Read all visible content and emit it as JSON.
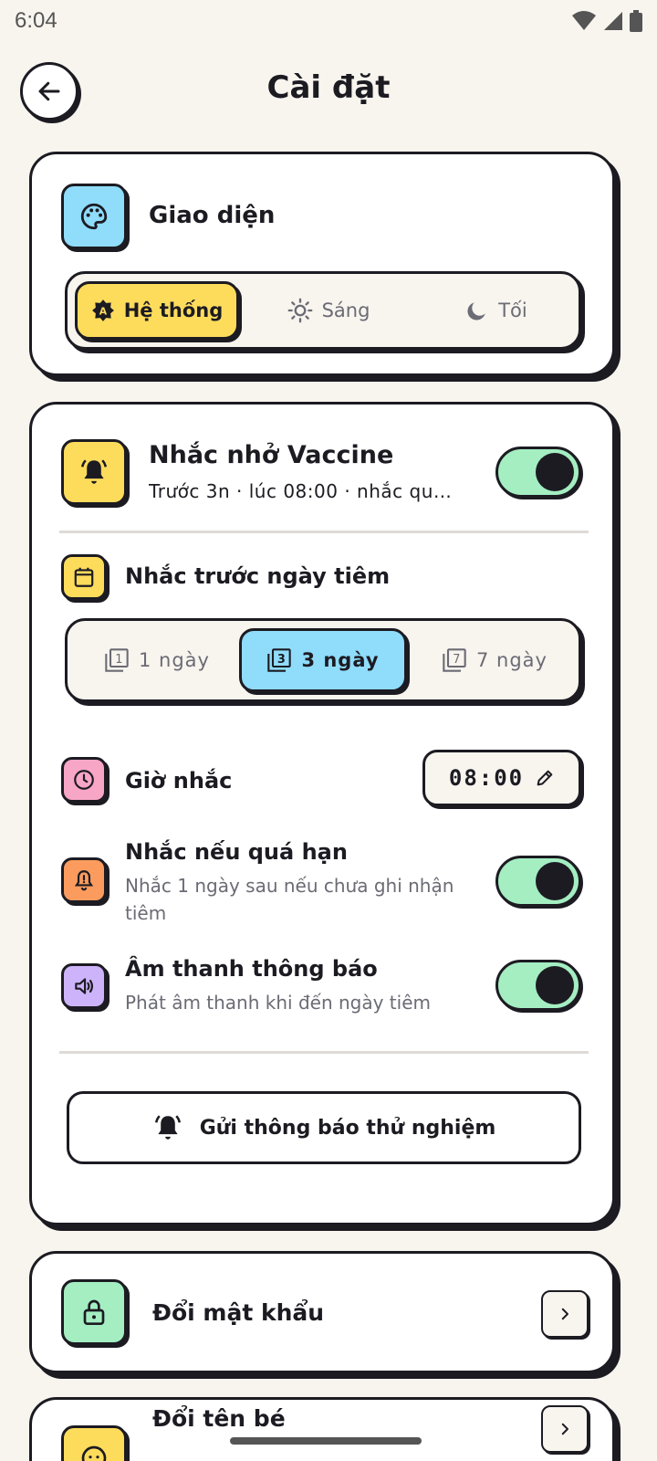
{
  "status_bar": {
    "time": "6:04"
  },
  "header": {
    "title": "Cài đặt"
  },
  "appearance": {
    "title": "Giao diện",
    "options": [
      {
        "label": "Hệ thống",
        "icon": "auto-theme-icon",
        "active": true
      },
      {
        "label": "Sáng",
        "icon": "sun-icon",
        "active": false
      },
      {
        "label": "Tối",
        "icon": "moon-icon",
        "active": false
      }
    ]
  },
  "vaccine": {
    "title": "Nhắc nhở Vaccine",
    "summary": "Trước 3n · lúc 08:00 · nhắc qu…",
    "enabled": true,
    "days_title": "Nhắc trước ngày tiêm",
    "days_options": [
      {
        "label": "1 ngày",
        "icon": "filter-1-icon",
        "active": false
      },
      {
        "label": "3 ngày",
        "icon": "filter-3-icon",
        "active": true
      },
      {
        "label": "7 ngày",
        "icon": "filter-7-icon",
        "active": false
      }
    ],
    "time_title": "Giờ nhắc",
    "time_value": "08:00",
    "overdue_title": "Nhắc nếu quá hạn",
    "overdue_desc": "Nhắc 1 ngày sau nếu chưa ghi nhận tiêm",
    "overdue_enabled": true,
    "sound_title": "Âm thanh thông báo",
    "sound_desc": "Phát âm thanh khi đến ngày tiêm",
    "sound_enabled": true,
    "test_button": "Gửi thông báo thử nghiệm"
  },
  "password": {
    "title": "Đổi mật khẩu"
  },
  "rename": {
    "title": "Đổi tên bé"
  },
  "colors": {
    "background": "#f8f4ee",
    "yellow": "#fddc5c",
    "blue": "#8fdcfb",
    "green": "#a4eec2",
    "pink": "#f8a6c6",
    "orange": "#fb9c5e",
    "purple": "#cdb4fa",
    "ink": "#1c1b22"
  }
}
